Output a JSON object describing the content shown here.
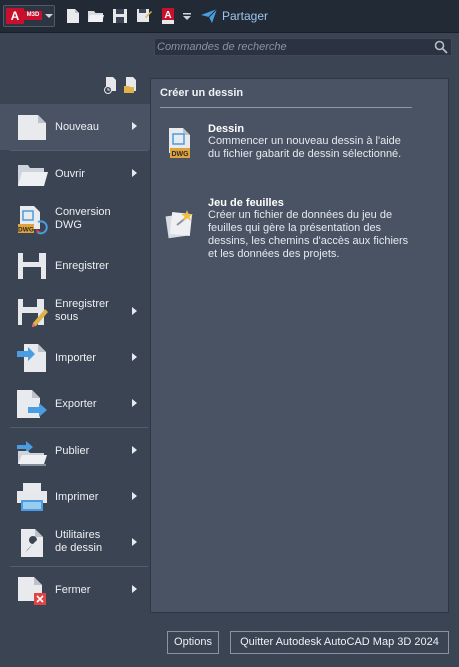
{
  "toolbar": {
    "app_letter": "A",
    "app_badge": "M3D",
    "share_label": "Partager"
  },
  "search": {
    "placeholder": "Commandes de recherche"
  },
  "menu": {
    "items": [
      {
        "label": "Nouveau",
        "has_submenu": true
      },
      {
        "label": "Ouvrir",
        "has_submenu": true
      },
      {
        "label_line1": "Conversion",
        "label_line2": "DWG",
        "has_submenu": false
      },
      {
        "label": "Enregistrer",
        "has_submenu": false
      },
      {
        "label_line1": "Enregistrer",
        "label_line2": "sous",
        "has_submenu": true
      },
      {
        "label": "Importer",
        "has_submenu": true
      },
      {
        "label": "Exporter",
        "has_submenu": true
      },
      {
        "label": "Publier",
        "has_submenu": true
      },
      {
        "label": "Imprimer",
        "has_submenu": true
      },
      {
        "label_line1": "Utilitaires",
        "label_line2": "de dessin",
        "has_submenu": true
      },
      {
        "label": "Fermer",
        "has_submenu": true
      }
    ],
    "active_index": 0
  },
  "panel": {
    "title": "Créer un dessin",
    "entries": [
      {
        "title": "Dessin",
        "description": "Commencer un nouveau dessin à l'aide du fichier gabarit de dessin sélectionné.",
        "icon_text": "DWG"
      },
      {
        "title": "Jeu de feuilles",
        "description": "Créer un fichier de données du jeu de feuilles qui gère la présentation des dessins, les chemins d'accès aux fichiers et les données des projets."
      }
    ]
  },
  "footer": {
    "options_label": "Options",
    "quit_label": "Quitter Autodesk AutoCAD Map 3D 2024"
  },
  "colors": {
    "toolbar_bg": "#222a35",
    "body_bg": "#3b4453",
    "panel_bg": "#4a5364",
    "brand_red": "#c8102e",
    "accent_blue": "#4a9de0"
  }
}
